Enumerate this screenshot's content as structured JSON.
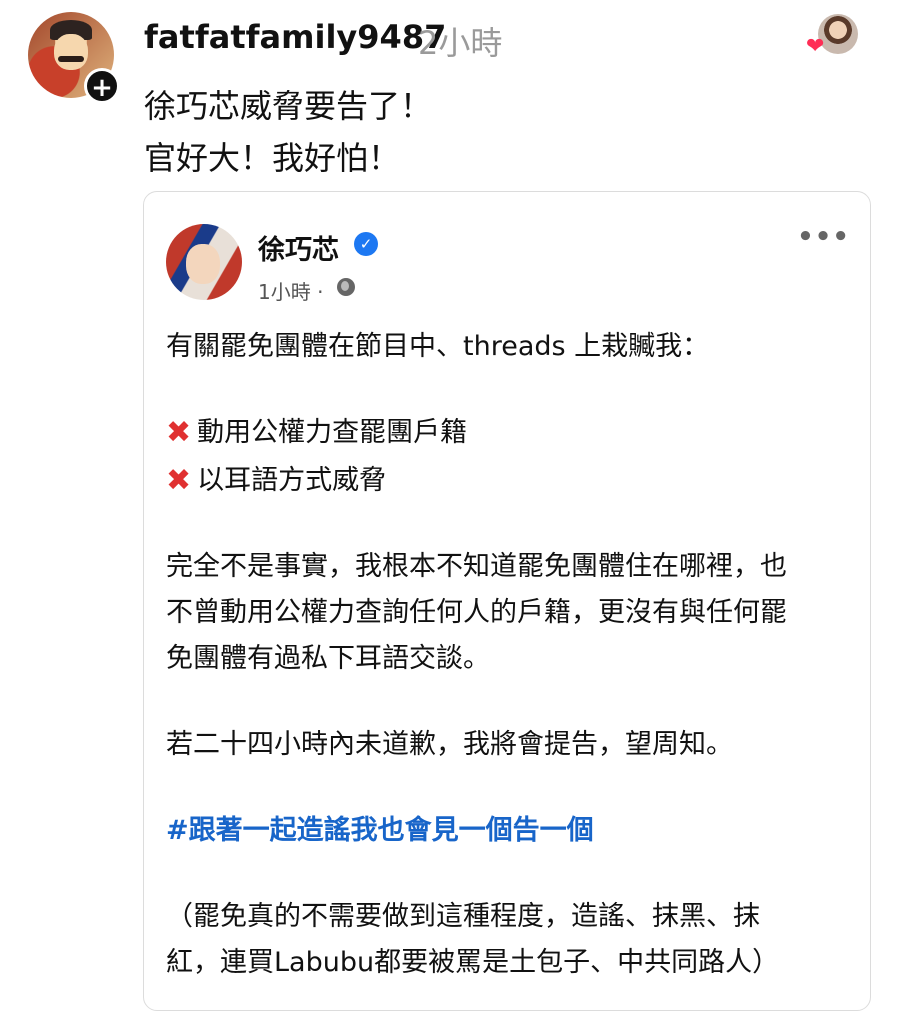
{
  "post": {
    "username": "fatfatfamily9487",
    "timestamp": "2小時",
    "caption_lines": [
      "徐巧芯威脅要告了！",
      "官好大！我好怕！"
    ]
  },
  "embedded": {
    "name": "徐巧芯",
    "time": "1小時 ·",
    "lines": {
      "l1": "有關罷免團體在節目中、threads 上栽贓我：",
      "x1": "動用公權力查罷團戶籍",
      "x2": "以耳語方式威脅",
      "p1a": "完全不是事實，我根本不知道罷免團體住在哪裡，也",
      "p1b": "不曾動用公權力查詢任何人的戶籍，更沒有與任何罷",
      "p1c": "免團體有過私下耳語交談。",
      "p2": "若二十四小時內未道歉，我將會提告，望周知。",
      "hashtag": "#跟著一起造謠我也會見一個告一個",
      "p3a": "（罷免真的不需要做到這種程度，造謠、抹黑、抹",
      "p3b": "紅，連買Labubu都要被罵是土包子、中共同路人）"
    }
  },
  "icons": {
    "follow": "+",
    "verified": "✓",
    "more": "•••",
    "x_mark": "✖",
    "heart": "❤"
  },
  "colors": {
    "hashtag": "#1865c9",
    "verified": "#1d78f2",
    "x_mark": "#e03131",
    "heart": "#ff2d55"
  }
}
